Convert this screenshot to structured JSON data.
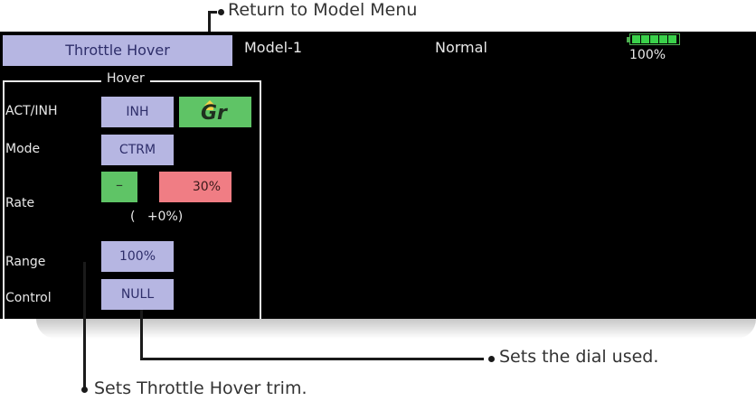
{
  "annotations": {
    "return_to_menu": "Return to Model Menu",
    "sets_dial": "Sets the dial used.",
    "sets_trim": "Sets Throttle Hover trim."
  },
  "header": {
    "title": "Throttle Hover",
    "model": "Model-1",
    "condition": "Normal",
    "battery_percent": "100%",
    "battery_level": 1.0
  },
  "panel": {
    "title": "Hover",
    "rows": {
      "act_inh": {
        "label": "ACT/INH",
        "value": "INH",
        "group_button": "Gr"
      },
      "mode": {
        "label": "Mode",
        "value": "CTRM"
      },
      "rate": {
        "label": "Rate",
        "minus_button": "–",
        "value": "30%",
        "offset": "(   +0%)"
      },
      "range": {
        "label": "Range",
        "value": "100%"
      },
      "control": {
        "label": "Control",
        "value": "NULL"
      }
    }
  },
  "colors": {
    "screen_bg": "#000000",
    "button": "#b6b6e2",
    "button_text": "#2e2e6a",
    "green_button": "#5fc466",
    "red_button": "#f07d84"
  }
}
